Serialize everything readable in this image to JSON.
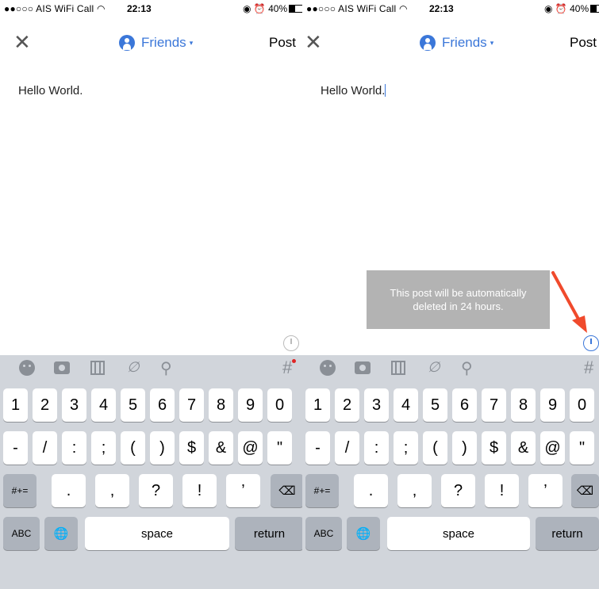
{
  "status": {
    "carrier": "●●○○○ AIS WiFi Call",
    "wifi_icon": "wifi-icon",
    "time": "22:13",
    "battery": "40%"
  },
  "nav": {
    "close": "✕",
    "audience": "Friends",
    "audience_caret": "▾",
    "post": "Post"
  },
  "composer": {
    "text": "Hello World."
  },
  "tooltip": {
    "text": "This post will be automatically deleted in 24 hours."
  },
  "toolbar": {
    "icons": [
      "emoji-icon",
      "camera-icon",
      "video-icon",
      "link-icon",
      "location-pin-icon",
      "hashtag-icon"
    ],
    "link_glyph": "∅",
    "pin_glyph": "⚲",
    "hashtag_glyph": "#"
  },
  "keyboard": {
    "row1": [
      "1",
      "2",
      "3",
      "4",
      "5",
      "6",
      "7",
      "8",
      "9",
      "0"
    ],
    "row2": [
      "-",
      "/",
      ":",
      ";",
      "(",
      ")",
      "$",
      "&",
      "@",
      "\""
    ],
    "row3": {
      "mode": "#+=",
      "keys": [
        ".",
        ",",
        "?",
        "!",
        "’"
      ],
      "delete": "⌫"
    },
    "row4": {
      "abc": "ABC",
      "globe": "🌐",
      "space": "space",
      "return": "return"
    }
  },
  "colors": {
    "accent": "#3b77d9",
    "arrow": "#f04a2c",
    "keyboard_bg": "#d1d5db"
  }
}
